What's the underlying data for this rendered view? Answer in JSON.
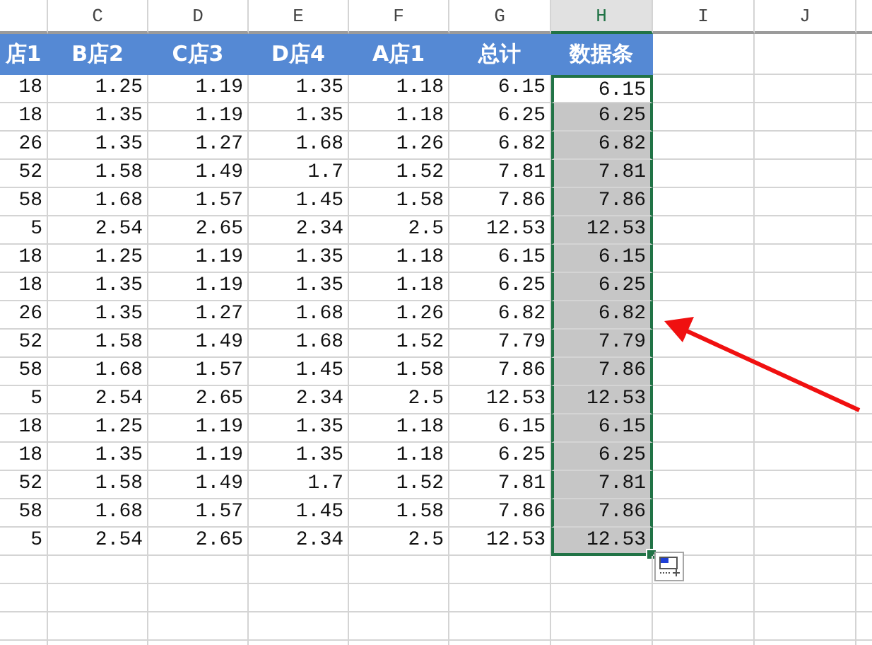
{
  "column_headers": [
    {
      "letter": "C",
      "selected": false
    },
    {
      "letter": "D",
      "selected": false
    },
    {
      "letter": "E",
      "selected": false
    },
    {
      "letter": "F",
      "selected": false
    },
    {
      "letter": "G",
      "selected": false
    },
    {
      "letter": "H",
      "selected": true
    },
    {
      "letter": "I",
      "selected": false
    },
    {
      "letter": "J",
      "selected": false
    }
  ],
  "title_row": [
    "店1",
    "B店2",
    "C店3",
    "D店4",
    "A店1",
    "总计",
    "数据条"
  ],
  "rows": [
    {
      "cells": [
        "18",
        "1.25",
        "1.19",
        "1.35",
        "1.18",
        "6.15"
      ],
      "bar": {
        "value": "6.15",
        "selected": true,
        "active": true
      }
    },
    {
      "cells": [
        "18",
        "1.35",
        "1.19",
        "1.35",
        "1.18",
        "6.25"
      ],
      "bar": {
        "value": "6.25",
        "selected": true,
        "active": false
      }
    },
    {
      "cells": [
        "26",
        "1.35",
        "1.27",
        "1.68",
        "1.26",
        "6.82"
      ],
      "bar": {
        "value": "6.82",
        "selected": true,
        "active": false
      }
    },
    {
      "cells": [
        "52",
        "1.58",
        "1.49",
        "1.7",
        "1.52",
        "7.81"
      ],
      "bar": {
        "value": "7.81",
        "selected": true,
        "active": false
      }
    },
    {
      "cells": [
        "58",
        "1.68",
        "1.57",
        "1.45",
        "1.58",
        "7.86"
      ],
      "bar": {
        "value": "7.86",
        "selected": true,
        "active": false
      }
    },
    {
      "cells": [
        "5",
        "2.54",
        "2.65",
        "2.34",
        "2.5",
        "12.53"
      ],
      "bar": {
        "value": "12.53",
        "selected": true,
        "active": false
      }
    },
    {
      "cells": [
        "18",
        "1.25",
        "1.19",
        "1.35",
        "1.18",
        "6.15"
      ],
      "bar": {
        "value": "6.15",
        "selected": true,
        "active": false
      }
    },
    {
      "cells": [
        "18",
        "1.35",
        "1.19",
        "1.35",
        "1.18",
        "6.25"
      ],
      "bar": {
        "value": "6.25",
        "selected": true,
        "active": false
      }
    },
    {
      "cells": [
        "26",
        "1.35",
        "1.27",
        "1.68",
        "1.26",
        "6.82"
      ],
      "bar": {
        "value": "6.82",
        "selected": true,
        "active": false
      }
    },
    {
      "cells": [
        "52",
        "1.58",
        "1.49",
        "1.68",
        "1.52",
        "7.79"
      ],
      "bar": {
        "value": "7.79",
        "selected": true,
        "active": false
      }
    },
    {
      "cells": [
        "58",
        "1.68",
        "1.57",
        "1.45",
        "1.58",
        "7.86"
      ],
      "bar": {
        "value": "7.86",
        "selected": true,
        "active": false
      }
    },
    {
      "cells": [
        "5",
        "2.54",
        "2.65",
        "2.34",
        "2.5",
        "12.53"
      ],
      "bar": {
        "value": "12.53",
        "selected": true,
        "active": false
      }
    },
    {
      "cells": [
        "18",
        "1.25",
        "1.19",
        "1.35",
        "1.18",
        "6.15"
      ],
      "bar": {
        "value": "6.15",
        "selected": true,
        "active": false
      }
    },
    {
      "cells": [
        "18",
        "1.35",
        "1.19",
        "1.35",
        "1.18",
        "6.25"
      ],
      "bar": {
        "value": "6.25",
        "selected": true,
        "active": false
      }
    },
    {
      "cells": [
        "52",
        "1.58",
        "1.49",
        "1.7",
        "1.52",
        "7.81"
      ],
      "bar": {
        "value": "7.81",
        "selected": true,
        "active": false
      }
    },
    {
      "cells": [
        "58",
        "1.68",
        "1.57",
        "1.45",
        "1.58",
        "7.86"
      ],
      "bar": {
        "value": "7.86",
        "selected": true,
        "active": false
      }
    },
    {
      "cells": [
        "5",
        "2.54",
        "2.65",
        "2.34",
        "2.5",
        "12.53"
      ],
      "bar": {
        "value": "12.53",
        "selected": true,
        "active": false
      }
    }
  ]
}
